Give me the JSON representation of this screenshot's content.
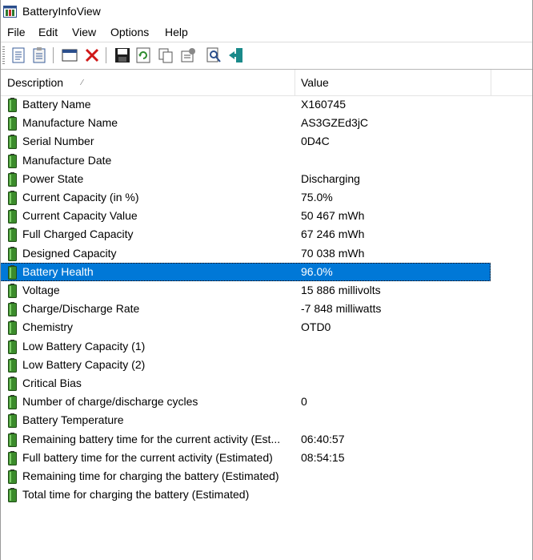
{
  "window": {
    "title": "BatteryInfoView"
  },
  "menu": {
    "items": [
      "File",
      "Edit",
      "View",
      "Options",
      "Help"
    ]
  },
  "toolbar": {
    "buttons": [
      "html-report-icon",
      "properties-list-icon",
      "window-icon",
      "delete-icon",
      "save-icon",
      "refresh-icon",
      "copy-icon",
      "properties-icon",
      "find-icon",
      "exit-icon"
    ]
  },
  "list": {
    "columns": {
      "description": "Description",
      "value": "Value"
    },
    "rows": [
      {
        "description": "Battery Name",
        "value": "X160745"
      },
      {
        "description": "Manufacture Name",
        "value": "AS3GZEd3jC"
      },
      {
        "description": "Serial Number",
        "value": "0D4C"
      },
      {
        "description": "Manufacture Date",
        "value": ""
      },
      {
        "description": "Power State",
        "value": "Discharging"
      },
      {
        "description": "Current Capacity (in %)",
        "value": "75.0%"
      },
      {
        "description": "Current Capacity Value",
        "value": "50 467 mWh"
      },
      {
        "description": "Full Charged Capacity",
        "value": "67 246 mWh"
      },
      {
        "description": "Designed Capacity",
        "value": "70 038 mWh"
      },
      {
        "description": "Battery Health",
        "value": "96.0%",
        "selected": true
      },
      {
        "description": "Voltage",
        "value": "15 886 millivolts"
      },
      {
        "description": "Charge/Discharge Rate",
        "value": "-7 848 milliwatts"
      },
      {
        "description": "Chemistry",
        "value": "OTD0"
      },
      {
        "description": "Low Battery Capacity (1)",
        "value": ""
      },
      {
        "description": "Low Battery Capacity (2)",
        "value": ""
      },
      {
        "description": "Critical Bias",
        "value": ""
      },
      {
        "description": "Number of charge/discharge cycles",
        "value": "0"
      },
      {
        "description": "Battery Temperature",
        "value": ""
      },
      {
        "description": "Remaining battery time for the current activity (Est...",
        "value": "06:40:57"
      },
      {
        "description": "Full battery time for the current activity (Estimated)",
        "value": "08:54:15"
      },
      {
        "description": "Remaining time for charging the battery (Estimated)",
        "value": ""
      },
      {
        "description": "Total  time for charging the battery (Estimated)",
        "value": ""
      }
    ]
  },
  "colors": {
    "selection": "#0078d7",
    "battery_green": "#3c8c2c"
  }
}
